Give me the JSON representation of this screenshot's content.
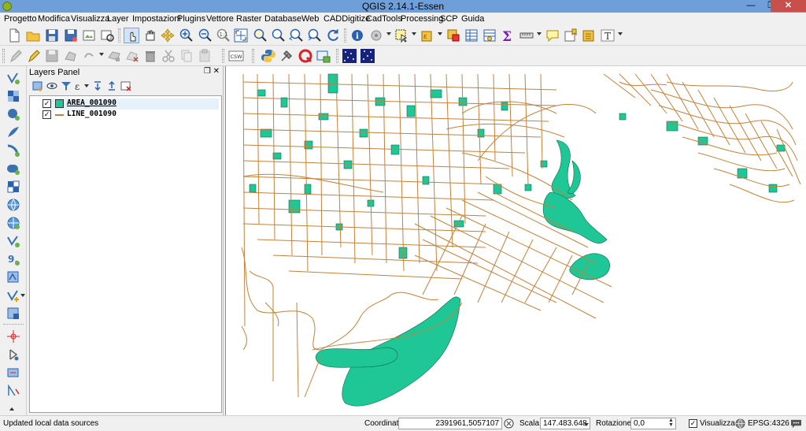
{
  "window": {
    "title": "QGIS 2.14.1-Essen"
  },
  "menubar": {
    "items": [
      "Progetto",
      "Modifica",
      "Visualizza",
      "Layer",
      "Impostazioni",
      "Plugins",
      "Vettore",
      "Raster",
      "Database",
      "Web",
      "CADDigitize",
      "CadTools",
      "Processing",
      "SCP",
      "Guida"
    ]
  },
  "toolbar2": {
    "csw_label": "CSW"
  },
  "layers_panel": {
    "title": "Layers Panel",
    "layers": [
      {
        "name": "AREA_001090",
        "visible": true,
        "symbol": "fill",
        "color": "#1fc796"
      },
      {
        "name": "LINE_001090",
        "visible": true,
        "symbol": "line",
        "color": "#c2823a"
      }
    ]
  },
  "statusbar": {
    "message": "Updated local data sources",
    "coordinate_label": "Coordinata",
    "coordinate_value": "2391961,5057107",
    "scale_label": "Scala",
    "scale_value": "147.483.648",
    "rotation_label": "Rotazione",
    "rotation_value": "0,0",
    "render_label": "Visualizza",
    "render_checked": true,
    "crs": "EPSG:4326"
  },
  "colors": {
    "area_fill": "#1fc796",
    "line_stroke": "#c2823a",
    "titlebar": "#6f9fd8"
  }
}
